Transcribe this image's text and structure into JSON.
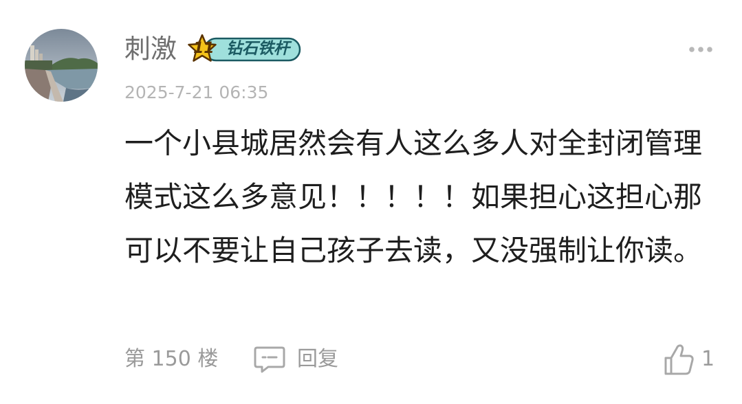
{
  "comment": {
    "author": {
      "name": "刺激",
      "avatar": "riverside-landscape-photo",
      "badge": {
        "level": "11",
        "title": "钻石铁杆",
        "icon": "star-icon"
      }
    },
    "timestamp": "2025-7-21 06:35",
    "text": "一个小县城居然会有人这么多人对全封闭管理模式这么多意见！！！！！如果担心这担心那可以不要让自己孩子去读，又没强制让你读。",
    "floor": "第 150 楼",
    "reply_label": "回复",
    "like_count": "1",
    "icons": {
      "more": "more-dots-icon",
      "reply": "comment-bubble-icon",
      "like": "thumbs-up-icon"
    }
  },
  "colors": {
    "name": "#6f6f6f",
    "meta": "#b4b4b4",
    "body": "#1e1e1e",
    "footer": "#9a9a9a",
    "badge_fill": "#9fe0dc",
    "star": "#f4c21a"
  }
}
